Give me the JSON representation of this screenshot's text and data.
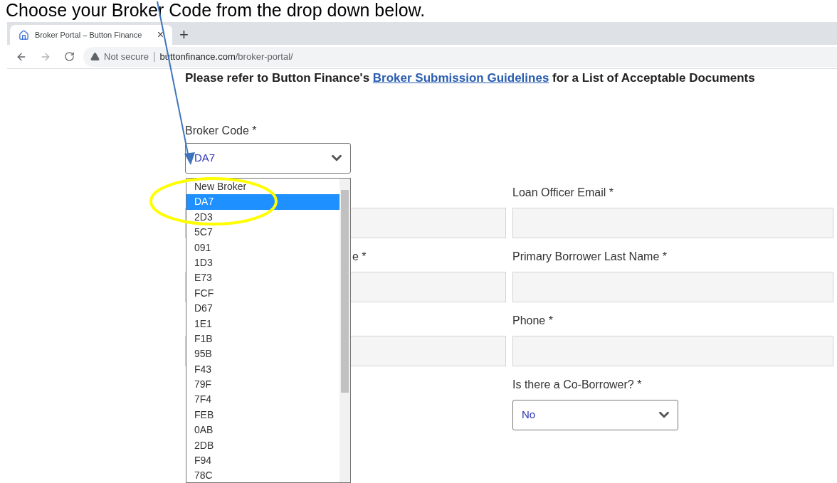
{
  "annotation": {
    "text": "Choose your Broker Code from the drop down below."
  },
  "browser": {
    "tab": {
      "title": "Broker Portal – Button Finance",
      "close": "×"
    },
    "new_tab": "+",
    "address": {
      "security": "Not secure",
      "separator": "|",
      "domain": "buttonfinance.com",
      "path": "/broker-portal/"
    }
  },
  "page": {
    "notice": {
      "before": "Please refer to Button Finance's ",
      "link": "Broker Submission Guidelines",
      "after": " for a List of Acceptable Documents"
    },
    "broker_code": {
      "label": "Broker Code *",
      "value": "DA7"
    },
    "rows": [
      {
        "left_input": true,
        "right": {
          "kind": "text",
          "label": "Loan Officer Email *"
        }
      },
      {
        "left_input": true,
        "left_label": "e *",
        "right": {
          "kind": "text",
          "label": "Primary Borrower Last Name *"
        }
      },
      {
        "left_input": true,
        "right": {
          "kind": "text",
          "label": "Phone *"
        }
      },
      {
        "left_input": false,
        "right": {
          "kind": "select",
          "label": "Is there a Co-Borrower? *",
          "value": "No"
        }
      }
    ],
    "dropdown": {
      "options": [
        {
          "label": "New Broker",
          "selected": false
        },
        {
          "label": "DA7",
          "selected": true
        },
        {
          "label": "2D3",
          "selected": false
        },
        {
          "label": "5C7",
          "selected": false
        },
        {
          "label": "091",
          "selected": false
        },
        {
          "label": "1D3",
          "selected": false
        },
        {
          "label": "E73",
          "selected": false
        },
        {
          "label": "FCF",
          "selected": false
        },
        {
          "label": "D67",
          "selected": false
        },
        {
          "label": "1E1",
          "selected": false
        },
        {
          "label": "F1B",
          "selected": false
        },
        {
          "label": "95B",
          "selected": false
        },
        {
          "label": "F43",
          "selected": false
        },
        {
          "label": "79F",
          "selected": false
        },
        {
          "label": "7F4",
          "selected": false
        },
        {
          "label": "FEB",
          "selected": false
        },
        {
          "label": "0AB",
          "selected": false
        },
        {
          "label": "2DB",
          "selected": false
        },
        {
          "label": "F94",
          "selected": false
        },
        {
          "label": "78C",
          "selected": false
        }
      ]
    }
  }
}
